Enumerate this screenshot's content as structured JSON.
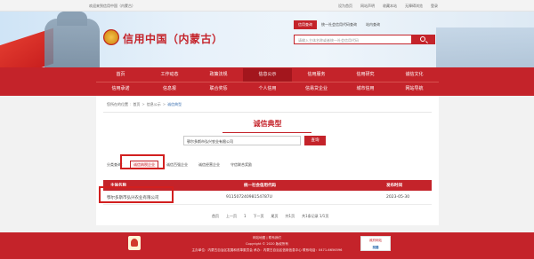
{
  "topbar": {
    "welcome": "欢迎来到信用中国（内蒙古）",
    "links": [
      "设为首页",
      "网站声明",
      "收藏本站",
      "无障碍浏览",
      "登录"
    ]
  },
  "header": {
    "site_title": "信用中国（内蒙古）",
    "search_tabs": [
      "信用查询",
      "统一社会信用代码查询",
      "站内查询"
    ],
    "search_placeholder": "请输入主体名称或者统一社会信用代码"
  },
  "nav": {
    "row1": [
      "首页",
      "工作动态",
      "政策法规",
      "信息公示",
      "信用服务",
      "信用研究",
      "诚信文化"
    ],
    "row2": [
      "信用承诺",
      "信息报",
      "联合奖惩",
      "个人信用",
      "信易贷企业",
      "城市信用",
      "网站导航"
    ],
    "active": "信息公示"
  },
  "breadcrumb": [
    "您所在的位置",
    "首页",
    "信息公示",
    "诚信典型"
  ],
  "page_title": "诚信典型",
  "query": {
    "value": "鄂尔多斯市弘兴农业有限公司",
    "button": "查询"
  },
  "categories": {
    "label": "分类查询：",
    "items": [
      "诚信纳税企业",
      "诚信百强企业",
      "诚信经营企业",
      "守信联合奖励"
    ],
    "active": "诚信纳税企业"
  },
  "table": {
    "headers": [
      "主体名称",
      "统一社会信用代码",
      "发布时间"
    ],
    "rows": [
      {
        "name": "鄂尔多斯市弘兴农业有限公司",
        "code": "91150724098154787U",
        "date": "2023-05-30"
      }
    ]
  },
  "pager": [
    "首页",
    "上一页",
    "1",
    "下一页",
    "尾页",
    "共1页",
    "共1条记录 1/1页"
  ],
  "footer": {
    "links": "网站地图 | 联系我们",
    "copyright": "Copyright © 2020 版权所有",
    "sponsor": "主办单位：内蒙古自治区发展和改革委员会   承办：内蒙古自治区信用信息中心   联系电话：0471-6656596",
    "badge_top": "政府网站",
    "badge_bottom": "找错"
  },
  "colors": {
    "brand_red": "#c4232a",
    "highlight": "#d21f1f"
  }
}
